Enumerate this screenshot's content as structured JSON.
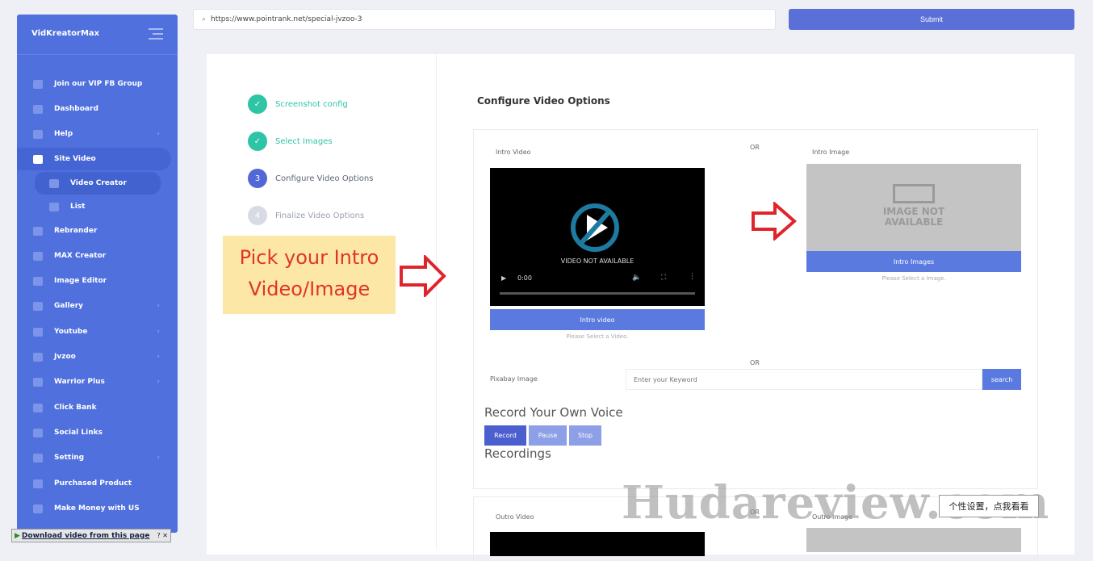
{
  "sidebar": {
    "brand": "VidKreatorMax",
    "items": [
      {
        "label": "Join our VIP FB Group",
        "icon": "facebook-icon"
      },
      {
        "label": "Dashboard",
        "icon": "dashboard-icon"
      },
      {
        "label": "Help",
        "icon": "help-icon",
        "chevron": true
      },
      {
        "label": "Site Video",
        "icon": "edit-icon",
        "active": true
      },
      {
        "label": "Video Creator",
        "icon": "file-icon",
        "sub": true
      },
      {
        "label": "List",
        "icon": "list-icon"
      },
      {
        "label": "Rebrander",
        "icon": "pencil-icon"
      },
      {
        "label": "MAX Creator",
        "icon": "play-icon"
      },
      {
        "label": "Image Editor",
        "icon": "eye-icon"
      },
      {
        "label": "Gallery",
        "icon": "video-icon",
        "chevron": true
      },
      {
        "label": "Youtube",
        "icon": "globe-icon",
        "chevron": true
      },
      {
        "label": "Jvzoo",
        "icon": "table-icon",
        "chevron": true
      },
      {
        "label": "Warrior Plus",
        "icon": "table-icon",
        "chevron": true
      },
      {
        "label": "Click Bank",
        "icon": "table-icon"
      },
      {
        "label": "Social Links",
        "icon": "basket-icon"
      },
      {
        "label": "Setting",
        "icon": "gear-icon",
        "chevron": true
      },
      {
        "label": "Purchased Product",
        "icon": "cart-icon"
      },
      {
        "label": "Make Money with US",
        "icon": "keyboard-icon"
      }
    ]
  },
  "header": {
    "url": "https://www.pointrank.net/special-jvzoo-3",
    "submit": "Submit"
  },
  "steps": [
    {
      "num": "✓",
      "label": "Screenshot config",
      "state": "done"
    },
    {
      "num": "✓",
      "label": "Select Images",
      "state": "done"
    },
    {
      "num": "3",
      "label": "Configure Video Options",
      "state": "current"
    },
    {
      "num": "4",
      "label": "Finalize Video Options",
      "state": "pending"
    }
  ],
  "main": {
    "title": "Configure Video Options",
    "intro_video_label": "Intro Video",
    "or": "OR",
    "intro_image_label": "Intro Image",
    "video_na": "VIDEO NOT AVAILABLE",
    "time": "0:00",
    "intro_video_btn": "Intro video",
    "video_hint": "Please Select a Video.",
    "image_na_1": "IMAGE NOT",
    "image_na_2": "AVAILABLE",
    "intro_images_btn": "Intro Images",
    "image_hint": "Please Select a Image.",
    "pixabay_label": "Pixabay Image",
    "keyword_placeholder": "Enter your Keyword",
    "search": "search",
    "record_heading": "Record Your Own Voice",
    "record": "Record",
    "pause": "Pause",
    "stop": "Stop",
    "recordings": "Recordings",
    "outro_video_label": "Outro Video",
    "outro_image_label": "Outro Image"
  },
  "annotation": {
    "line1": "Pick your Intro",
    "line2": "Video/Image"
  },
  "watermark": "Hudareview.com",
  "tooltip": "个性设置，点我看看",
  "download_bar": "Download video from this page",
  "colors": {
    "accent": "#5a7ae0",
    "sidebar": "#4f70dd",
    "step_done": "#2ec4a6",
    "annotation_bg": "#fde7a6",
    "annotation_text": "#e0342b"
  }
}
